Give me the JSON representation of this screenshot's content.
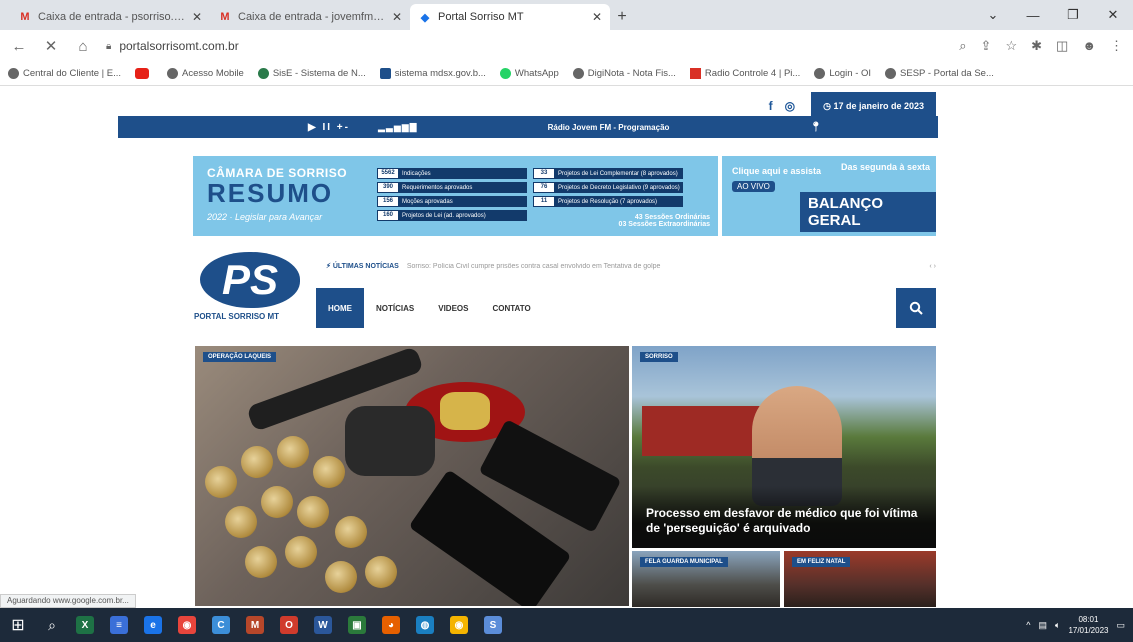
{
  "browser": {
    "tabs": [
      {
        "icon": "M",
        "icon_color": "#d93025",
        "title": "Caixa de entrada - psorriso.mt@",
        "active": false
      },
      {
        "icon": "M",
        "icon_color": "#d93025",
        "title": "Caixa de entrada - jovemfm.com",
        "active": false
      },
      {
        "icon": "◆",
        "icon_color": "#1a73e8",
        "title": "Portal Sorriso MT",
        "active": true
      }
    ],
    "new_tab": "+",
    "url": "portalsorrisomt.com.br",
    "bookmarks": [
      "Central do Cliente | E...",
      "",
      "Acesso Mobile",
      "SisE - Sistema de N...",
      "sistema mdsx.gov.b...",
      "WhatsApp",
      "DigiNota - Nota Fis...",
      "Radio Controle 4 | Pi...",
      "Login - OI",
      "SESP - Portal da Se..."
    ]
  },
  "site": {
    "date": "17 de janeiro de 2023",
    "radio": {
      "controls": "▶ II +-",
      "volume": "▂▃▅▆▇",
      "station": "Rádio Jovem FM - Programação"
    },
    "banner": {
      "org": "CÂMARA DE SORRISO",
      "title": "RESUMO",
      "year": "2022",
      "signature": "Legislar para Avançar",
      "stats_left": [
        {
          "n": "5562",
          "label": "Indicações"
        },
        {
          "n": "390",
          "label": "Requerimentos aprovados"
        },
        {
          "n": "156",
          "label": "Moções aprovadas"
        },
        {
          "n": "160",
          "label": "Projetos de Lei (ad. aprovados)"
        }
      ],
      "stats_right": [
        {
          "n": "33",
          "label": "Projetos de Lei Complementar (8 aprovados)"
        },
        {
          "n": "76",
          "label": "Projetos de Decreto Legislativo (9 aprovados)"
        },
        {
          "n": "11",
          "label": "Projetos de Resolução (7 aprovados)"
        }
      ],
      "sessions": [
        "43 Sessões Ordinárias",
        "03 Sessões Extraordinárias"
      ]
    },
    "side_banner": {
      "click": "Clique aqui e assista",
      "live": "AO VIVO",
      "title": "BALANÇO GERAL",
      "right": "Das segunda à sexta"
    },
    "logo": {
      "mark": "PS",
      "name": "PORTAL SORRISO MT"
    },
    "ticker": {
      "label": "ÚLTIMAS NOTÍCIAS",
      "text": "Sorriso: Polícia Civil cumpre prisões contra casal envolvido em Tentativa de golpe",
      "arrows": "‹  ›"
    },
    "nav": [
      "HOME",
      "NOTÍCIAS",
      "VIDEOS",
      "CONTATO"
    ],
    "featured_left": {
      "category": "OPERAÇÃO LAQUEIS"
    },
    "featured_right": {
      "category": "SORRISO",
      "title": "Processo em desfavor de médico que foi vítima de 'perseguição' é arquivado"
    },
    "small1": {
      "category": "FELA GUARDA MUNICIPAL"
    },
    "small2": {
      "category": "EM FELIZ NATAL"
    }
  },
  "status": "Aguardando www.google.com.br...",
  "taskbar": {
    "apps": [
      {
        "label": "X",
        "color": "#1e7145"
      },
      {
        "label": "≡",
        "color": "#3a6fd8"
      },
      {
        "label": "e",
        "color": "#1a73e8"
      },
      {
        "label": "◉",
        "color": "#e8453c"
      },
      {
        "label": "C",
        "color": "#3c8ed8"
      },
      {
        "label": "M",
        "color": "#b7472a"
      },
      {
        "label": "O",
        "color": "#d03b2c"
      },
      {
        "label": "W",
        "color": "#2b579a"
      },
      {
        "label": "▣",
        "color": "#2b7a3b"
      },
      {
        "label": "◕",
        "color": "#e66000"
      },
      {
        "label": "◍",
        "color": "#1a7fc1"
      },
      {
        "label": "◉",
        "color": "#f4b400"
      },
      {
        "label": "S",
        "color": "#5b8dd9"
      }
    ],
    "time": "08:01",
    "date": "17/01/2023"
  }
}
